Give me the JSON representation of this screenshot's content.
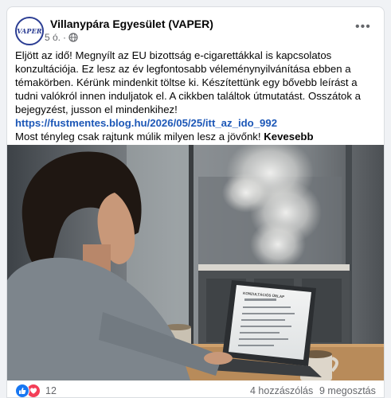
{
  "post": {
    "page_name": "Villanypára Egyesület (VAPER)",
    "avatar_text": "VAPER",
    "time": "5 ó.",
    "separator": "·",
    "paragraph1": "Eljött az idő! Megnyílt az EU bizottság e-cigarettákkal is kapcsolatos konzultációja. Ez lesz az év legfontosabb véleménynyilvánítása ebben a témakörben. Kérünk mindenkit töltse ki. Készítettünk egy bővebb leírást a tudni valókról innen induljatok el. A cikkben találtok útmutatást. Osszátok a bejegyzést, jusson el mindenkihez!",
    "link": "https://fustmentes.blog.hu/2026/05/25/itt_az_ido_992",
    "closing": "Most tényleg csak rajtunk múlik milyen lesz a jövőnk!",
    "see_less": "Kevesebb megjelenítése"
  },
  "photo": {
    "laptop_heading": "KONZULTÁCIÓS ŰRLAP"
  },
  "stats": {
    "reaction_count": "12",
    "comments": "4 hozzászólás",
    "shares": "9 megosztás"
  },
  "icons": {
    "globe": "globe-icon",
    "more": "more-options-icon",
    "like": "like-reaction-icon",
    "love": "love-reaction-icon"
  },
  "colors": {
    "link": "#1c57b7",
    "like": "#1877f2",
    "love": "#f33e58",
    "brand": "#2b3d93"
  }
}
